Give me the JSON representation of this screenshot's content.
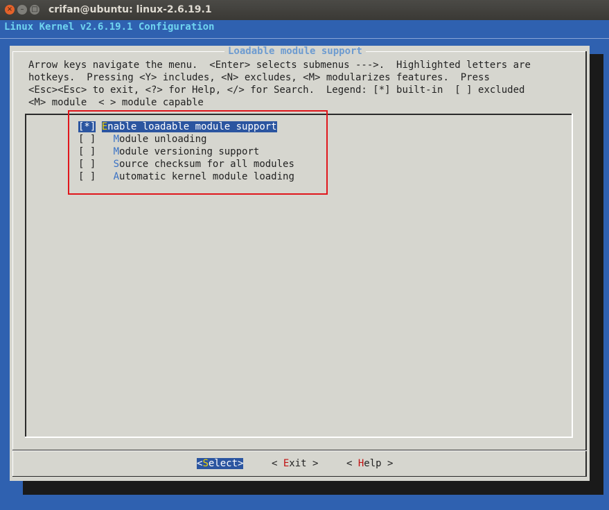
{
  "window": {
    "title": "crifan@ubuntu: linux-2.6.19.1",
    "close_glyph": "×",
    "min_glyph": "–",
    "max_glyph": "□"
  },
  "backtitle": "Linux Kernel v2.6.19.1 Configuration",
  "dialog": {
    "title": "Loadable module support",
    "help_lines": [
      "Arrow keys navigate the menu.  <Enter> selects submenus --->.  Highlighted letters are",
      "hotkeys.  Pressing <Y> includes, <N> excludes, <M> modularizes features.  Press",
      "<Esc><Esc> to exit, <?> for Help, </> for Search.  Legend: [*] built-in  [ ] excluded",
      "<M> module  < > module capable"
    ]
  },
  "menu": {
    "items": [
      {
        "box": "[*]",
        "hot": "E",
        "rest": "nable loadable module support",
        "indent": " ",
        "selected": true
      },
      {
        "box": "[ ]",
        "hot": "M",
        "rest": "odule unloading",
        "indent": "   "
      },
      {
        "box": "[ ]",
        "hot": "M",
        "rest": "odule versioning support",
        "indent": "   "
      },
      {
        "box": "[ ]",
        "hot": "S",
        "rest": "ource checksum for all modules",
        "indent": "   "
      },
      {
        "box": "[ ]",
        "hot": "A",
        "rest": "utomatic kernel module loading",
        "indent": "   "
      }
    ]
  },
  "buttons": {
    "select": {
      "open": "<",
      "hot": "S",
      "rest": "elect",
      "close": ">"
    },
    "exit": {
      "open": "< ",
      "hot": "E",
      "rest": "xit",
      "close": " >"
    },
    "help": {
      "open": "< ",
      "hot": "H",
      "rest": "elp",
      "close": " >"
    }
  },
  "colors": {
    "desktop": "#2f61b0",
    "dialog_bg": "#d6d6cf",
    "selection": "#2b55a0",
    "hotkey_menu": "#3a72c4",
    "hotkey_button": "#c01010",
    "annotation_box": "#e0161b"
  }
}
